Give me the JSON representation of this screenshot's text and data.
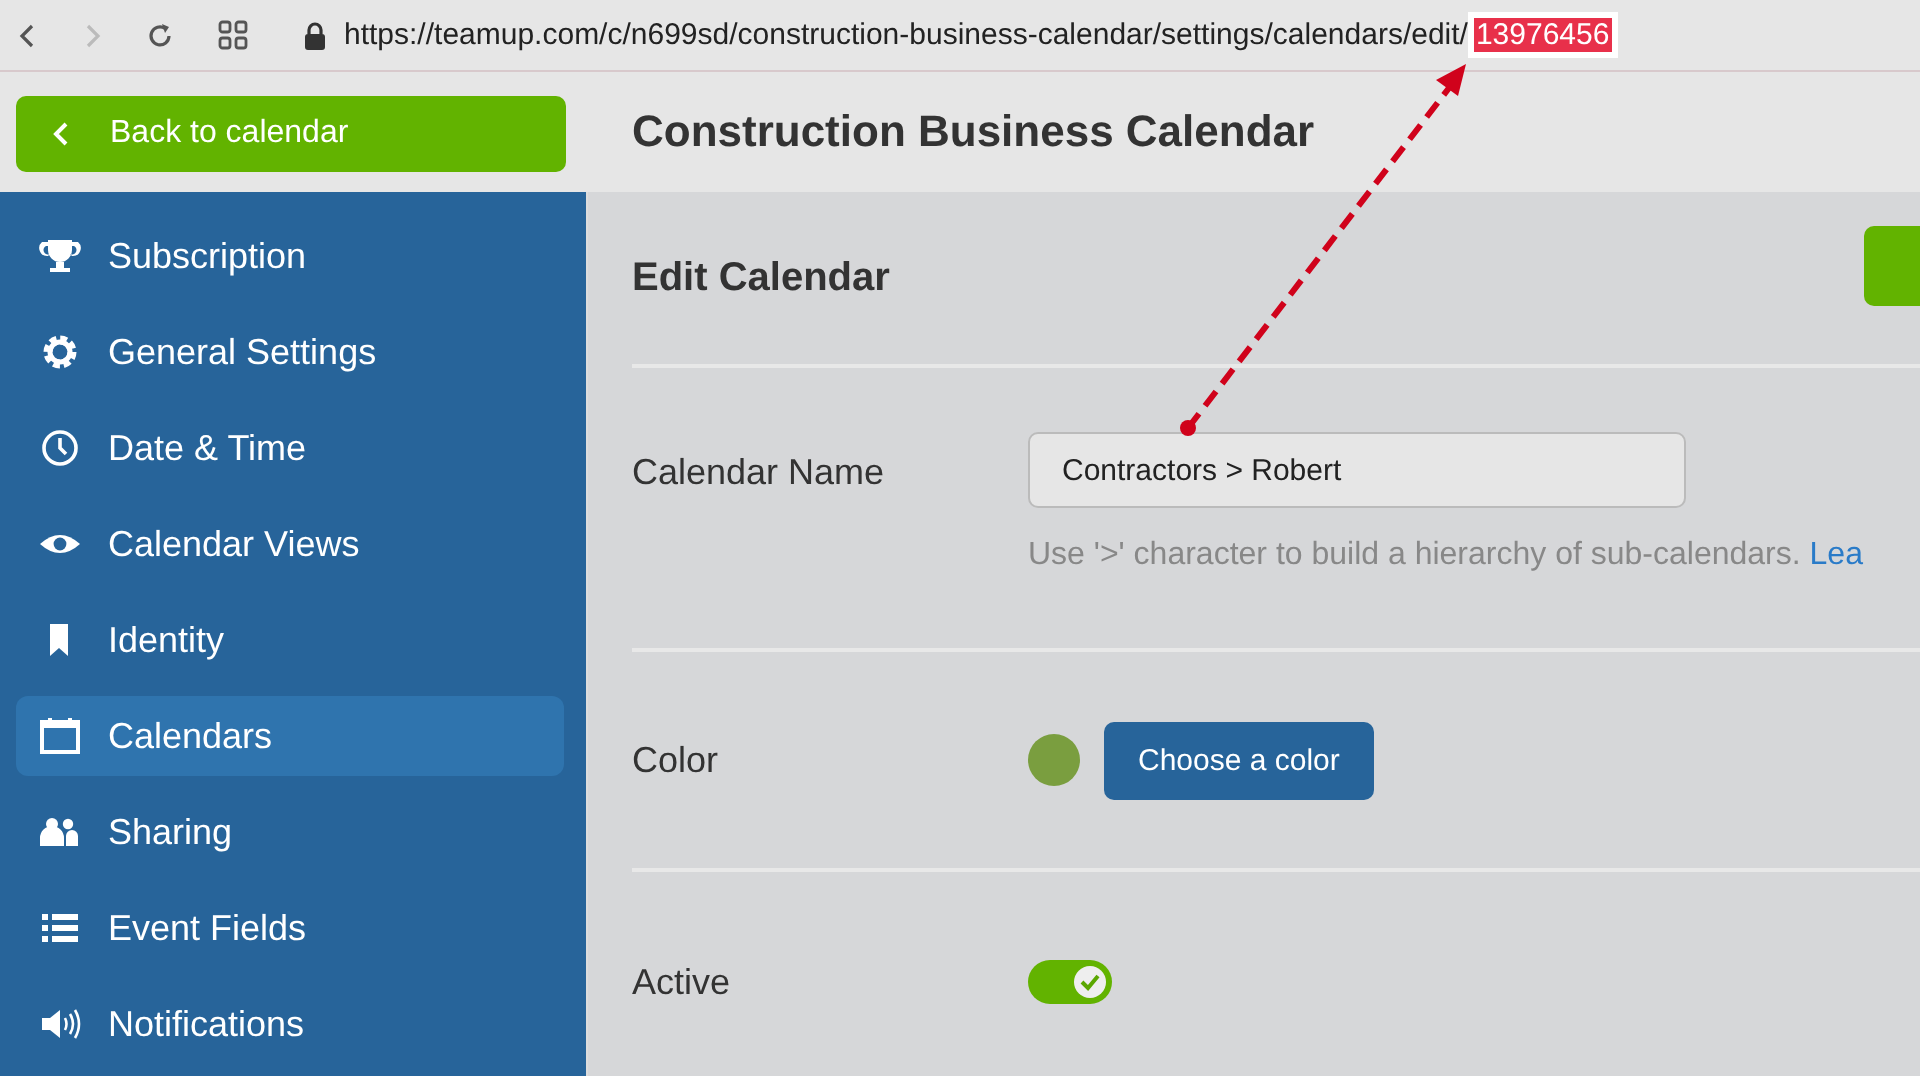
{
  "browser": {
    "url": "https://teamup.com/c/n699sd/construction-business-calendar/settings/calendars/edit/",
    "url_highlight": "13976456",
    "forward_disabled": true
  },
  "sidebar": {
    "back_label": "Back to calendar",
    "items": [
      {
        "label": "Subscription",
        "selected": false
      },
      {
        "label": "General Settings",
        "selected": false
      },
      {
        "label": "Date & Time",
        "selected": false
      },
      {
        "label": "Calendar Views",
        "selected": false
      },
      {
        "label": "Identity",
        "selected": false
      },
      {
        "label": "Calendars",
        "selected": true
      },
      {
        "label": "Sharing",
        "selected": false
      },
      {
        "label": "Event Fields",
        "selected": false
      },
      {
        "label": "Notifications",
        "selected": false
      }
    ]
  },
  "header": {
    "title": "Construction Business Calendar"
  },
  "form": {
    "title": "Edit Calendar",
    "name": {
      "label": "Calendar Name",
      "value": "Contractors > Robert",
      "help": "Use '>' character to build a hierarchy of sub-calendars.",
      "help_link": "Lea"
    },
    "color": {
      "label": "Color",
      "color": "#7a9e3f",
      "button": "Choose a color"
    },
    "active": {
      "label": "Active",
      "on": true
    }
  }
}
